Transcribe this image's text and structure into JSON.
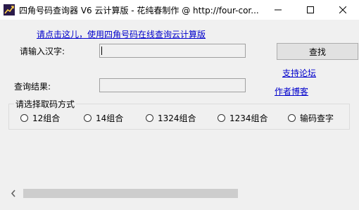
{
  "window": {
    "title": "四角号码查询器 V6 云计算版 - 花纯春制作 @ http://four-cor...",
    "minimize_icon": "minimize-icon",
    "maximize_icon": "maximize-icon",
    "close_icon": "close-icon"
  },
  "top_link": "请点击这儿，使用四角号码在线查询云计算版",
  "input": {
    "label": "请输入汉字:",
    "value": ""
  },
  "search_button": "查找",
  "forum_link": "支持论坛",
  "result": {
    "label": "查询结果:",
    "value": ""
  },
  "blog_link": "作者博客",
  "options": {
    "title": "请选择取码方式",
    "items": [
      {
        "label": "12组合",
        "checked": false
      },
      {
        "label": "14组合",
        "checked": false
      },
      {
        "label": "1324组合",
        "checked": false
      },
      {
        "label": "1234组合",
        "checked": false
      },
      {
        "label": "输码查字",
        "checked": false
      }
    ]
  },
  "colors": {
    "link": "#0000cc",
    "background": "#f0f0f0"
  }
}
